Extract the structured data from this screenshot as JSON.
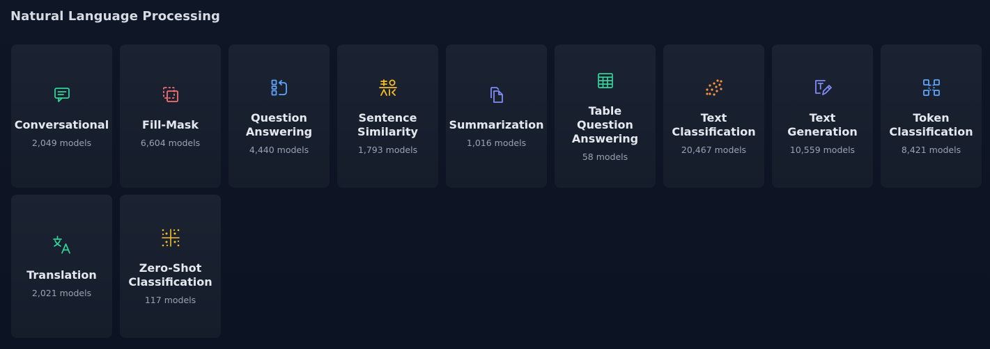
{
  "section": {
    "title": "Natural Language Processing"
  },
  "tasks": [
    {
      "label": "Conversational",
      "count": "2,049 models",
      "icon": "chat-bubble-icon",
      "color": "#34d399"
    },
    {
      "label": "Fill-Mask",
      "count": "6,604 models",
      "icon": "fill-mask-icon",
      "color": "#f87171"
    },
    {
      "label": "Question Answering",
      "count": "4,440 models",
      "icon": "question-answering-icon",
      "color": "#60a5fa"
    },
    {
      "label": "Sentence Similarity",
      "count": "1,793 models",
      "icon": "sentence-similarity-icon",
      "color": "#fbbf24"
    },
    {
      "label": "Summarization",
      "count": "1,016 models",
      "icon": "documents-icon",
      "color": "#818cf8"
    },
    {
      "label": "Table Question Answering",
      "count": "58 models",
      "icon": "table-icon",
      "color": "#34d399"
    },
    {
      "label": "Text Classification",
      "count": "20,467 models",
      "icon": "scatter-dots-icon",
      "color": "#fb923c"
    },
    {
      "label": "Text Generation",
      "count": "10,559 models",
      "icon": "text-pencil-icon",
      "color": "#818cf8"
    },
    {
      "label": "Token Classification",
      "count": "8,421 models",
      "icon": "token-blocks-icon",
      "color": "#60a5fa"
    },
    {
      "label": "Translation",
      "count": "2,021 models",
      "icon": "translate-icon",
      "color": "#34d399"
    },
    {
      "label": "Zero-Shot Classification",
      "count": "117 models",
      "icon": "sparkle-grid-icon",
      "color": "#fbbf24"
    }
  ]
}
